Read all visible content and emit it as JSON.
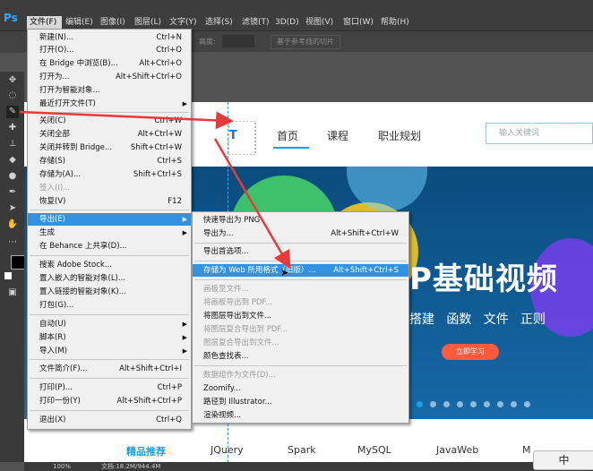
{
  "app": {
    "logo": "Ps"
  },
  "menubar": {
    "items": [
      "文件(F)",
      "编辑(E)",
      "图像(I)",
      "图层(L)",
      "文字(Y)",
      "选择(S)",
      "滤镜(T)",
      "3D(D)",
      "视图(V)",
      "窗口(W)",
      "帮助(H)"
    ]
  },
  "options_bar": {
    "label": "基于参考线的切片",
    "field_label": "高度:"
  },
  "file_menu": {
    "items": [
      {
        "label": "新建(N)...",
        "shortcut": "Ctrl+N"
      },
      {
        "label": "打开(O)...",
        "shortcut": "Ctrl+O"
      },
      {
        "label": "在 Bridge 中浏览(B)...",
        "shortcut": "Alt+Ctrl+O"
      },
      {
        "label": "打开为...",
        "shortcut": "Alt+Shift+Ctrl+O"
      },
      {
        "label": "打开为智能对象...",
        "shortcut": ""
      },
      {
        "label": "最近打开文件(T)",
        "shortcut": "",
        "submenu": true
      },
      {
        "label": "关闭(C)",
        "shortcut": "Ctrl+W"
      },
      {
        "label": "关闭全部",
        "shortcut": "Alt+Ctrl+W"
      },
      {
        "label": "关闭并转到 Bridge...",
        "shortcut": "Shift+Ctrl+W"
      },
      {
        "label": "存储(S)",
        "shortcut": "Ctrl+S"
      },
      {
        "label": "存储为(A)...",
        "shortcut": "Shift+Ctrl+S"
      },
      {
        "label": "签入(I)...",
        "shortcut": "",
        "disabled": true
      },
      {
        "label": "恢复(V)",
        "shortcut": "F12"
      },
      {
        "label": "导出(E)",
        "shortcut": "",
        "submenu": true,
        "highlighted": true
      },
      {
        "label": "生成",
        "shortcut": "",
        "submenu": true
      },
      {
        "label": "在 Behance 上共享(D)...",
        "shortcut": ""
      },
      {
        "label": "搜索 Adobe Stock...",
        "shortcut": ""
      },
      {
        "label": "置入嵌入的智能对象(L)...",
        "shortcut": ""
      },
      {
        "label": "置入链接的智能对象(K)...",
        "shortcut": ""
      },
      {
        "label": "打包(G)...",
        "shortcut": ""
      },
      {
        "label": "自动(U)",
        "shortcut": "",
        "submenu": true
      },
      {
        "label": "脚本(R)",
        "shortcut": "",
        "submenu": true
      },
      {
        "label": "导入(M)",
        "shortcut": "",
        "submenu": true
      },
      {
        "label": "文件简介(F)...",
        "shortcut": "Alt+Shift+Ctrl+I"
      },
      {
        "label": "打印(P)...",
        "shortcut": "Ctrl+P"
      },
      {
        "label": "打印一份(Y)",
        "shortcut": "Alt+Shift+Ctrl+P"
      },
      {
        "label": "退出(X)",
        "shortcut": "Ctrl+Q"
      }
    ]
  },
  "export_submenu": {
    "items": [
      {
        "label": "快速导出为 PNG",
        "shortcut": ""
      },
      {
        "label": "导出为...",
        "shortcut": "Alt+Shift+Ctrl+W"
      },
      {
        "label": "导出首选项...",
        "shortcut": ""
      },
      {
        "label": "存储为 Web 所用格式（旧版）...",
        "shortcut": "Alt+Shift+Ctrl+S",
        "highlighted": true
      },
      {
        "label": "画板至文件...",
        "shortcut": "",
        "disabled": true
      },
      {
        "label": "将画板导出到 PDF...",
        "shortcut": "",
        "disabled": true
      },
      {
        "label": "将图层导出到文件...",
        "shortcut": ""
      },
      {
        "label": "将图层复合导出到 PDF...",
        "shortcut": "",
        "disabled": true
      },
      {
        "label": "图层复合导出到文件...",
        "shortcut": "",
        "disabled": true
      },
      {
        "label": "颜色查找表...",
        "shortcut": ""
      },
      {
        "label": "数据组作为文件(D)...",
        "shortcut": "",
        "disabled": true
      },
      {
        "label": "Zoomify...",
        "shortcut": ""
      },
      {
        "label": "路径到 Illustrator...",
        "shortcut": ""
      },
      {
        "label": "渲染视频...",
        "shortcut": ""
      }
    ]
  },
  "website": {
    "nav": [
      "首页",
      "课程",
      "职业规划"
    ],
    "search_placeholder": "输入关键词",
    "banner_title": "P基础视频",
    "banner_subtitle": "搭建   函数   文件   正则",
    "banner_button": "立即学习",
    "courses": [
      "精品推荐",
      "JQuery",
      "Spark",
      "MySQL",
      "JavaWeb",
      "M"
    ]
  },
  "statusbar": {
    "zoom": "100%",
    "doc_info": "文档:18.2M/944.4M"
  },
  "ime": {
    "label": "中"
  },
  "colors": {
    "menu_highlight": "#3292e0",
    "annotation_arrow": "#e83a3a",
    "accent": "#1aa0e0"
  }
}
